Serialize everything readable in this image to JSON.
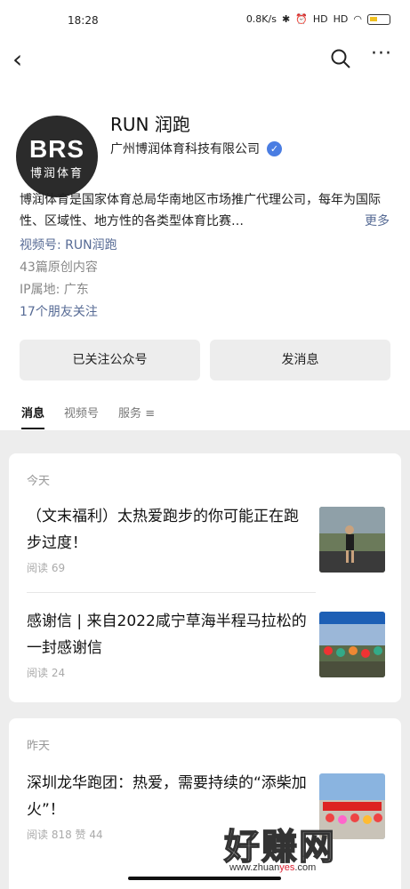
{
  "status": {
    "time": "18:28",
    "net_speed": "0.8K/s",
    "signal1": "HD",
    "signal2": "HD",
    "battery": "83"
  },
  "account": {
    "name": "RUN 润跑",
    "company": "广州博润体育科技有限公司",
    "logo_big": "BRS",
    "logo_small": "博润体育",
    "description": "博润体育是国家体育总局华南地区市场推广代理公司，每年为国际性、区域性、地方性的各类型体育比赛…",
    "more": "更多",
    "video_id": "视频号: RUN润跑",
    "articles": "43篇原创内容",
    "ip": "IP属地: 广东",
    "friends": "17个朋友关注"
  },
  "actions": {
    "followed": "已关注公众号",
    "message": "发消息"
  },
  "tabs": [
    "消息",
    "视频号",
    "服务"
  ],
  "feed": {
    "today_label": "今天",
    "yesterday_label": "昨天",
    "articles": [
      {
        "title": "（文末福利）太热爱跑步的你可能正在跑步过度！",
        "stats": "阅读 69"
      },
      {
        "title": "感谢信 | 来自2022咸宁草海半程马拉松的一封感谢信",
        "stats": "阅读 24"
      },
      {
        "title": "深圳龙华跑团：热爱，需要持续的“添柴加火”！",
        "stats": "阅读 818   赞 44"
      }
    ]
  },
  "watermark": {
    "text": "好赚网",
    "url_a": "www.zhuan",
    "url_b": "yes",
    "url_c": ".com"
  }
}
